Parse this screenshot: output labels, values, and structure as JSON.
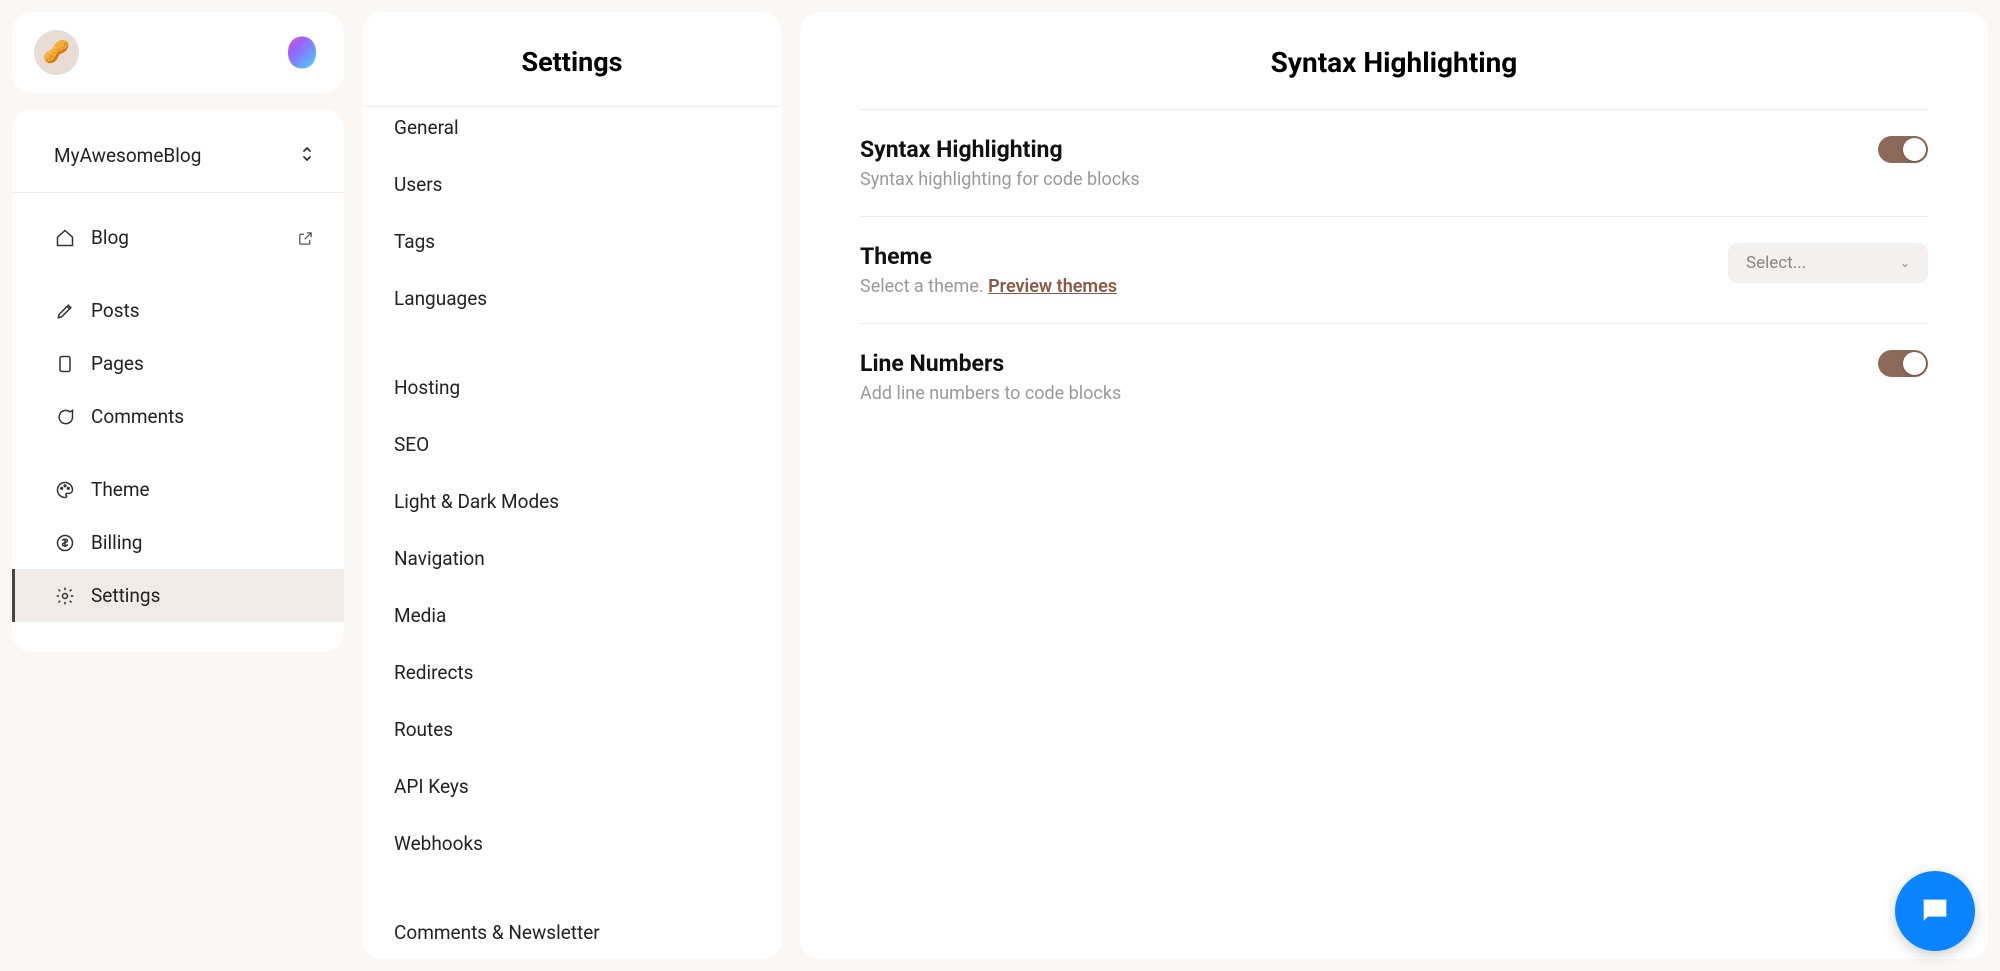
{
  "header": {
    "logo_emoji": "🥜"
  },
  "sidebar": {
    "site_name": "MyAwesomeBlog",
    "items": [
      {
        "label": "Blog",
        "icon": "home",
        "external": true
      },
      {
        "label": "Posts",
        "icon": "pencil"
      },
      {
        "label": "Pages",
        "icon": "page"
      },
      {
        "label": "Comments",
        "icon": "chat"
      },
      {
        "label": "Theme",
        "icon": "palette"
      },
      {
        "label": "Billing",
        "icon": "dollar"
      },
      {
        "label": "Settings",
        "icon": "gear",
        "active": true
      }
    ]
  },
  "settings_panel": {
    "title": "Settings",
    "groups": [
      [
        "General",
        "Users",
        "Tags",
        "Languages"
      ],
      [
        "Hosting",
        "SEO",
        "Light & Dark Modes",
        "Navigation",
        "Media",
        "Redirects",
        "Routes",
        "API Keys",
        "Webhooks"
      ],
      [
        "Comments & Newsletter"
      ]
    ]
  },
  "main": {
    "title": "Syntax Highlighting",
    "rows": [
      {
        "label": "Syntax Highlighting",
        "desc": "Syntax highlighting for code blocks",
        "control": "toggle",
        "value": true
      },
      {
        "label": "Theme",
        "desc_prefix": "Select a theme. ",
        "desc_link": "Preview themes",
        "control": "select",
        "placeholder": "Select..."
      },
      {
        "label": "Line Numbers",
        "desc": "Add line numbers to code blocks",
        "control": "toggle",
        "value": true
      }
    ]
  }
}
